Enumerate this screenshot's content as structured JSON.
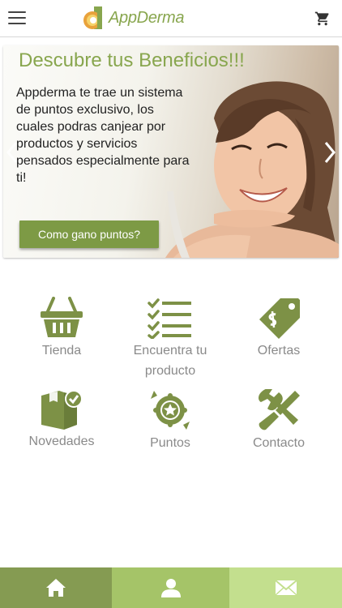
{
  "header": {
    "app_name": "AppDerma",
    "menu_icon": "hamburger-menu-icon",
    "cart_icon": "shopping-cart-icon"
  },
  "banner": {
    "title": "Descubre tus Beneficios!!!",
    "text": "Appderma te trae un sistema de puntos exclusivo, los cuales podras canjear por productos y servicios pensados especialmente para ti!",
    "button_label": "Como gano puntos?"
  },
  "menu": {
    "items": [
      {
        "label": "Tienda",
        "icon": "shopping-basket-icon"
      },
      {
        "label": "Encuentra tu producto",
        "icon": "checklist-icon"
      },
      {
        "label": "Ofertas",
        "icon": "price-tag-icon"
      },
      {
        "label": "Novedades",
        "icon": "box-check-icon"
      },
      {
        "label": "Puntos",
        "icon": "badge-star-icon"
      },
      {
        "label": "Contacto",
        "icon": "tools-icon"
      }
    ]
  },
  "tabbar": {
    "tabs": [
      {
        "icon": "home-icon"
      },
      {
        "icon": "user-icon"
      },
      {
        "icon": "mail-icon"
      }
    ]
  },
  "colors": {
    "brand_green": "#88a64e",
    "icon_green": "#7d9146",
    "label_gray": "#8a8a8a",
    "tab_dark": "#859b52",
    "tab_mid": "#a5c468",
    "tab_light": "#c3df8e"
  }
}
